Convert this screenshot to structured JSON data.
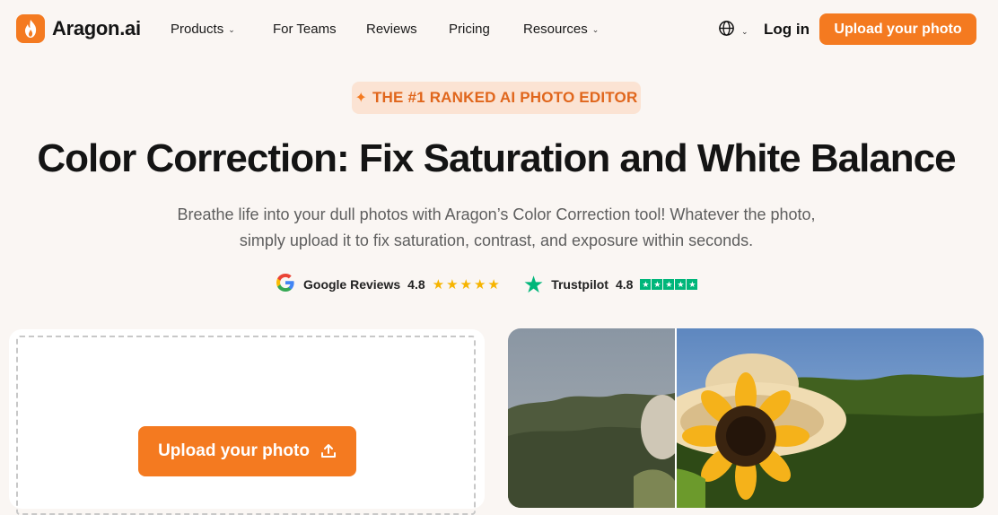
{
  "nav": {
    "brand": "Aragon.ai",
    "items": [
      {
        "label": "Products",
        "has_dropdown": true
      },
      {
        "label": "For Teams",
        "has_dropdown": false
      },
      {
        "label": "Reviews",
        "has_dropdown": false
      },
      {
        "label": "Pricing",
        "has_dropdown": false
      },
      {
        "label": "Resources",
        "has_dropdown": true
      }
    ],
    "login_label": "Log in",
    "cta_label": "Upload your photo"
  },
  "hero": {
    "badge": "THE #1 RANKED AI PHOTO EDITOR",
    "title": "Color Correction: Fix Saturation and White Balance",
    "subtitle_line1": "Breathe life into your dull photos with Aragon’s Color Correction tool! Whatever the photo,",
    "subtitle_line2": "simply upload it to fix saturation, contrast, and exposure within seconds."
  },
  "ratings": {
    "google": {
      "label": "Google Reviews",
      "score": "4.8",
      "stars": 5
    },
    "trustpilot": {
      "label": "Trustpilot",
      "score": "4.8",
      "stars": 5
    }
  },
  "upload": {
    "button_label": "Upload your photo"
  },
  "colors": {
    "accent": "#f47a20",
    "badge_bg": "#fbe3d3",
    "background": "#faf6f3",
    "trustpilot_green": "#00b67a",
    "google_star": "#f6b400"
  },
  "icons": {
    "logo": "flame-icon",
    "language": "globe-icon",
    "dropdown": "chevron-down-icon",
    "badge": "sparkle-icon",
    "google": "google-g-icon",
    "trustpilot": "trustpilot-star-icon",
    "upload": "upload-icon"
  }
}
